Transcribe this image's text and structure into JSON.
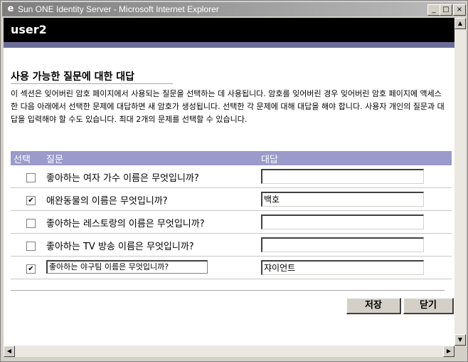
{
  "window": {
    "title": "Sun ONE Identity Server - Microsoft Internet Explorer",
    "minimize": "_",
    "maximize": "□",
    "close": "×"
  },
  "header": {
    "user": "user2"
  },
  "section": {
    "title": "사용 가능한 질문에 대한 대답",
    "description": "이 섹션은 잊어버린 암호 페이지에서 사용되는 질문을 선택하는 데 사용됩니다. 암호를 잊어버린 경우 잊어버린 암호 페이지에 액세스한 다음 아래에서 선택한 문제에 대답하면 새 암호가 생성됩니다. 선택한 각 문제에 대해 대답을 해야 합니다. 사용자 개인의 질문과 대답을 입력해야 할 수도 있습니다. 최대 2개의 문제를 선택할 수 있습니다."
  },
  "table": {
    "headers": {
      "select": "선택",
      "question": "질문",
      "answer": "대답"
    },
    "rows": [
      {
        "checked": false,
        "check_mark": "",
        "question": "좋아하는 여자 가수 이름은 무엇입니까?",
        "answer": ""
      },
      {
        "checked": true,
        "check_mark": "✔",
        "question": "애완동물의 이름은 무엇입니까?",
        "answer": "백호"
      },
      {
        "checked": false,
        "check_mark": "",
        "question": "좋아하는 레스토랑의 이름은 무엇입니까?",
        "answer": ""
      },
      {
        "checked": false,
        "check_mark": "",
        "question": "좋아하는 TV 방송 이름은 무엇입니까?",
        "answer": ""
      },
      {
        "checked": true,
        "check_mark": "✔",
        "question": "좋아하는 야구팀 이름은 무엇입니까?",
        "answer": "쟈이언트"
      }
    ]
  },
  "buttons": {
    "save": "저장",
    "close": "닫기"
  },
  "scrollbars": {
    "up": "▲",
    "down": "▼",
    "left": "◀",
    "right": "▶"
  }
}
